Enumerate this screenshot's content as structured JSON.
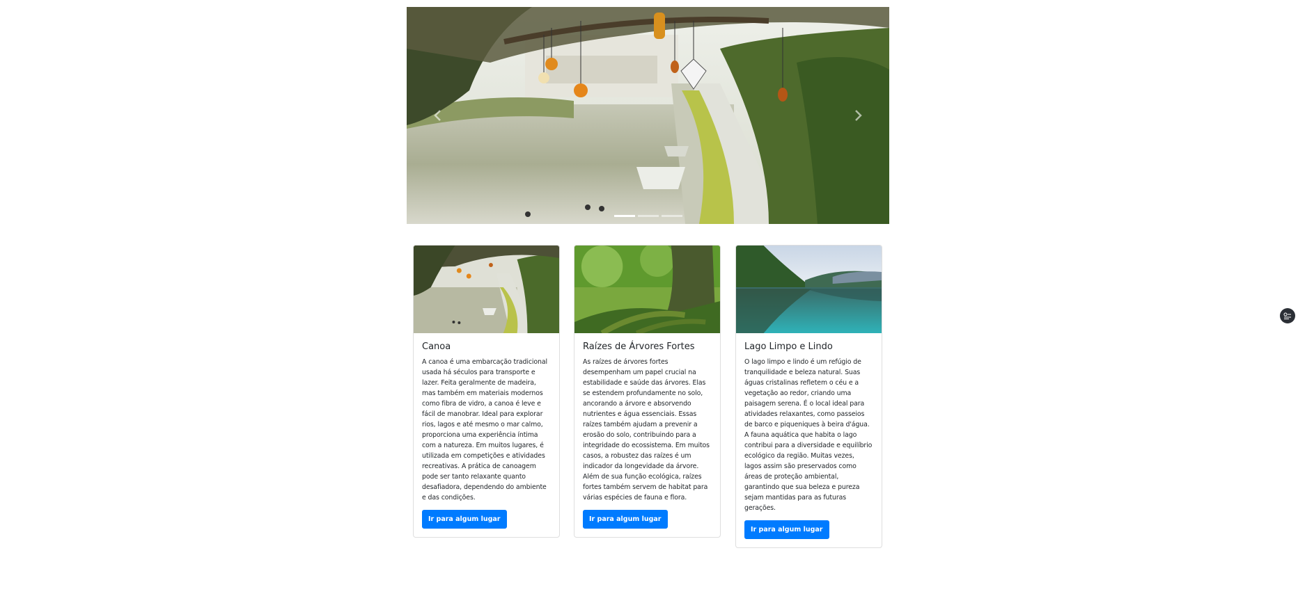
{
  "carousel": {
    "prev_label": "Previous",
    "next_label": "Next",
    "indicator_count": 3,
    "active_indicator": 1
  },
  "cards": [
    {
      "title": "Canoa",
      "text": "A canoa é uma embarcação tradicional usada há séculos para transporte e lazer. Feita geralmente de madeira, mas também em materiais modernos como fibra de vidro, a canoa é leve e fácil de manobrar. Ideal para explorar rios, lagos e até mesmo o mar calmo, proporciona uma experiência íntima com a natureza. Em muitos lugares, é utilizada em competições e atividades recreativas. A prática de canoagem pode ser tanto relaxante quanto desafiadora, dependendo do ambiente e das condições.",
      "button": "Ir para algum lugar",
      "image": "canal-with-lanterns"
    },
    {
      "title": "Raízes de Árvores Fortes",
      "text": "As raízes de árvores fortes desempenham um papel crucial na estabilidade e saúde das árvores. Elas se estendem profundamente no solo, ancorando a árvore e absorvendo nutrientes e água essenciais. Essas raízes também ajudam a prevenir a erosão do solo, contribuindo para a integridade do ecossistema. Em muitos casos, a robustez das raízes é um indicador da longevidade da árvore. Além de sua função ecológica, raízes fortes também servem de habitat para várias espécies de fauna e flora.",
      "button": "Ir para algum lugar",
      "image": "mossy-tree-roots"
    },
    {
      "title": "Lago Limpo e Lindo",
      "text": "O lago limpo e lindo é um refúgio de tranquilidade e beleza natural. Suas águas cristalinas refletem o céu e a vegetação ao redor, criando uma paisagem serena. É o local ideal para atividades relaxantes, como passeios de barco e piqueniques à beira d'água. A fauna aquática que habita o lago contribui para a diversidade e equilíbrio ecológico da região. Muitas vezes, lagos assim são preservados como áreas de proteção ambiental, garantindo que sua beleza e pureza sejam mantidas para as futuras gerações.",
      "button": "Ir para algum lugar",
      "image": "mountain-lake"
    }
  ]
}
